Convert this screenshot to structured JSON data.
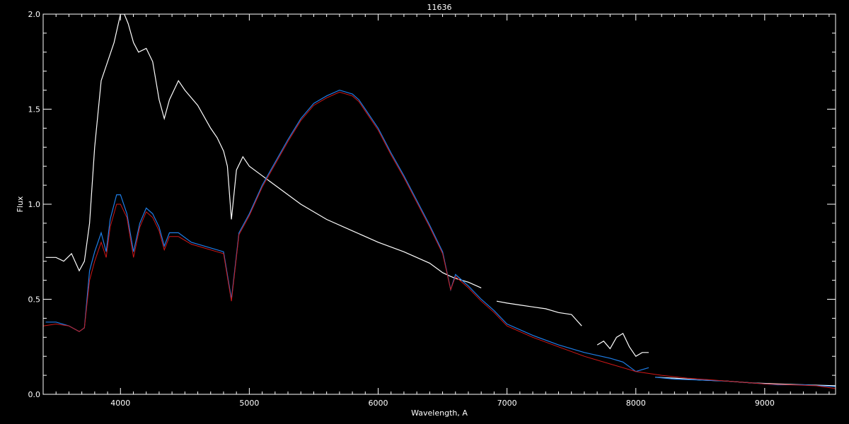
{
  "chart_data": {
    "type": "line",
    "title": "11636",
    "xlabel": "Wavelength, A",
    "ylabel": "Flux",
    "xlim": [
      3400,
      9550
    ],
    "ylim": [
      0.0,
      2.0
    ],
    "x_ticks": [
      4000,
      5000,
      6000,
      7000,
      8000,
      9000
    ],
    "x_tick_labels": [
      "4000",
      "5000",
      "6000",
      "7000",
      "8000",
      "9000"
    ],
    "y_ticks": [
      0.0,
      0.5,
      1.0,
      1.5,
      2.0
    ],
    "y_tick_labels": [
      "0.0",
      "0.5",
      "1.0",
      "1.5",
      "2.0"
    ],
    "grid": false,
    "colors": {
      "background": "#000000",
      "axes": "#ffffff",
      "white_series": "#ffffff",
      "blue_series": "#1e7ee8",
      "red_series": "#d01818"
    },
    "series": [
      {
        "color": "#ffffff",
        "segments": [
          {
            "x": [
              3420,
              3500,
              3560,
              3620,
              3680,
              3720,
              3760,
              3800,
              3850,
              3900,
              3950,
              4000,
              4030,
              4060,
              4101,
              4140,
              4200,
              4250,
              4300,
              4340,
              4380,
              4450,
              4500,
              4600,
              4700,
              4750,
              4800,
              4830,
              4861,
              4900,
              4950,
              5000,
              5100,
              5200,
              5400,
              5600,
              5800,
              6000,
              6200,
              6400,
              6500,
              6563,
              6600,
              6700,
              6800
            ],
            "y": [
              0.72,
              0.72,
              0.7,
              0.74,
              0.65,
              0.7,
              0.9,
              1.3,
              1.65,
              1.75,
              1.85,
              2.0,
              2.0,
              1.95,
              1.85,
              1.8,
              1.82,
              1.75,
              1.55,
              1.45,
              1.55,
              1.65,
              1.6,
              1.52,
              1.4,
              1.35,
              1.28,
              1.2,
              0.92,
              1.18,
              1.25,
              1.2,
              1.15,
              1.1,
              1.0,
              0.92,
              0.86,
              0.8,
              0.75,
              0.69,
              0.64,
              0.62,
              0.61,
              0.59,
              0.56
            ]
          },
          {
            "x": [
              6920,
              7000,
              7100,
              7200,
              7300,
              7400,
              7500,
              7580
            ],
            "y": [
              0.49,
              0.48,
              0.47,
              0.46,
              0.45,
              0.43,
              0.42,
              0.36
            ]
          },
          {
            "x": [
              7700,
              7750,
              7800,
              7850,
              7900,
              7950,
              8000,
              8050,
              8100
            ],
            "y": [
              0.26,
              0.28,
              0.24,
              0.3,
              0.32,
              0.25,
              0.2,
              0.22,
              0.22
            ]
          },
          {
            "x": [
              8150,
              8300,
              8500,
              8700,
              8900,
              9100,
              9300,
              9550
            ],
            "y": [
              0.09,
              0.085,
              0.075,
              0.07,
              0.06,
              0.055,
              0.05,
              0.045
            ]
          }
        ]
      },
      {
        "color": "#1e7ee8",
        "segments": [
          {
            "x": [
              3420,
              3500,
              3600,
              3680,
              3720,
              3760,
              3800,
              3850,
              3889,
              3920,
              3970,
              4000,
              4050,
              4101,
              4150,
              4200,
              4250,
              4300,
              4340,
              4380,
              4450,
              4550,
              4650,
              4750,
              4800,
              4861,
              4920,
              5000,
              5100,
              5200,
              5300,
              5400,
              5500,
              5600,
              5700,
              5800,
              5850,
              5900,
              6000,
              6100,
              6200,
              6300,
              6400,
              6500,
              6563,
              6600,
              6700,
              6800,
              6900,
              7000,
              7200,
              7400,
              7600,
              7800,
              7900,
              8000,
              8100
            ],
            "y": [
              0.38,
              0.38,
              0.36,
              0.33,
              0.35,
              0.65,
              0.75,
              0.85,
              0.75,
              0.92,
              1.05,
              1.05,
              0.95,
              0.75,
              0.9,
              0.98,
              0.95,
              0.88,
              0.78,
              0.85,
              0.85,
              0.8,
              0.78,
              0.76,
              0.75,
              0.5,
              0.85,
              0.95,
              1.1,
              1.22,
              1.34,
              1.45,
              1.53,
              1.57,
              1.6,
              1.58,
              1.55,
              1.5,
              1.4,
              1.27,
              1.15,
              1.02,
              0.89,
              0.75,
              0.55,
              0.63,
              0.57,
              0.5,
              0.44,
              0.37,
              0.31,
              0.26,
              0.22,
              0.19,
              0.17,
              0.12,
              0.14
            ]
          },
          {
            "x": [
              8150,
              8300,
              8500,
              8700,
              8900,
              9100,
              9300,
              9550
            ],
            "y": [
              0.09,
              0.08,
              0.075,
              0.07,
              0.06,
              0.05,
              0.05,
              0.04
            ]
          }
        ]
      },
      {
        "color": "#d01818",
        "segments": [
          {
            "x": [
              3400,
              3500,
              3600,
              3680,
              3720,
              3760,
              3800,
              3850,
              3889,
              3920,
              3970,
              4000,
              4050,
              4101,
              4150,
              4200,
              4250,
              4300,
              4340,
              4380,
              4450,
              4550,
              4650,
              4750,
              4800,
              4861,
              4920,
              5000,
              5100,
              5200,
              5300,
              5400,
              5500,
              5600,
              5700,
              5800,
              5850,
              5900,
              6000,
              6100,
              6200,
              6300,
              6400,
              6500,
              6563,
              6600,
              6700,
              6800,
              6900,
              7000,
              7200,
              7400,
              7600,
              7800,
              8000,
              8200,
              8400,
              8600,
              8800,
              9000,
              9200,
              9400,
              9550
            ],
            "y": [
              0.36,
              0.37,
              0.36,
              0.33,
              0.35,
              0.6,
              0.7,
              0.8,
              0.72,
              0.88,
              1.0,
              1.0,
              0.93,
              0.72,
              0.88,
              0.96,
              0.93,
              0.86,
              0.76,
              0.83,
              0.83,
              0.79,
              0.77,
              0.75,
              0.74,
              0.49,
              0.84,
              0.94,
              1.09,
              1.21,
              1.33,
              1.44,
              1.52,
              1.56,
              1.59,
              1.57,
              1.54,
              1.49,
              1.39,
              1.26,
              1.14,
              1.01,
              0.88,
              0.74,
              0.55,
              0.62,
              0.56,
              0.49,
              0.43,
              0.36,
              0.3,
              0.25,
              0.2,
              0.16,
              0.12,
              0.1,
              0.085,
              0.075,
              0.065,
              0.055,
              0.05,
              0.045,
              0.03
            ]
          }
        ]
      }
    ]
  }
}
